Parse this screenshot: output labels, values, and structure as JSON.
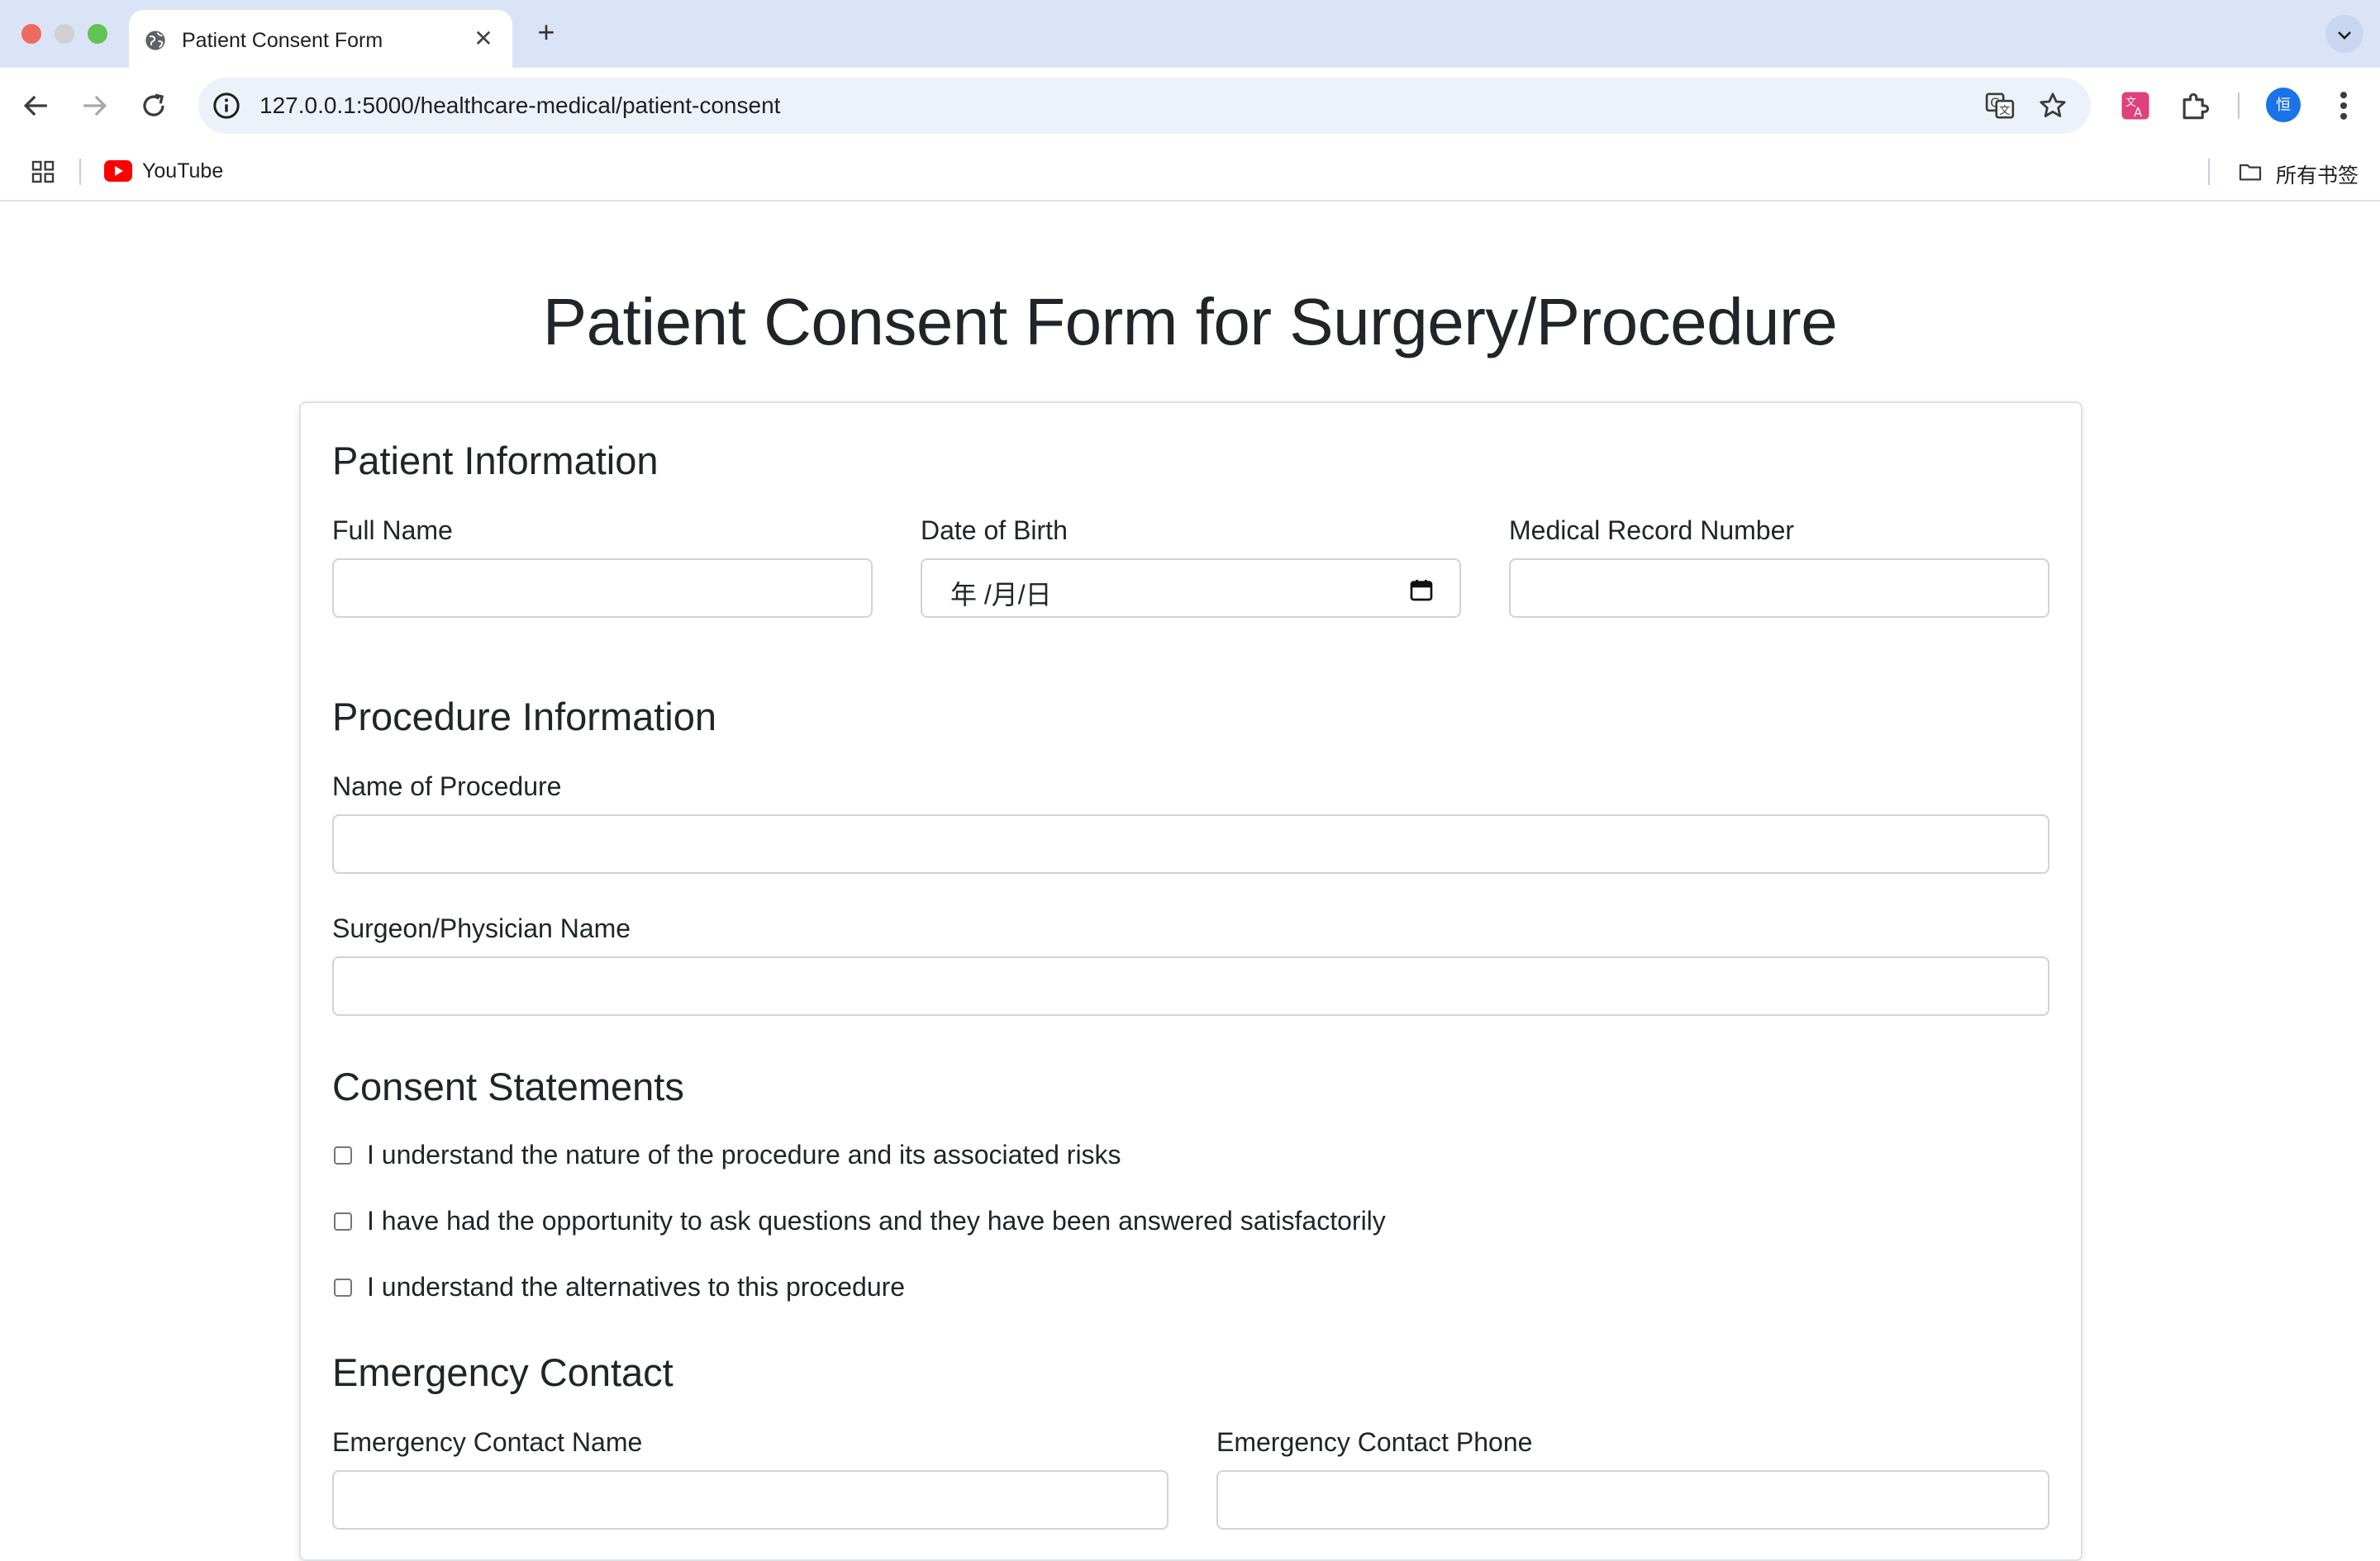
{
  "browser": {
    "tab_title": "Patient Consent Form",
    "url": "127.0.0.1:5000/healthcare-medical/patient-consent",
    "avatar_initial": "恒",
    "bookmarks": [
      {
        "label": "YouTube",
        "icon": "youtube-icon"
      }
    ],
    "all_bookmarks_label": "所有书签"
  },
  "page": {
    "title": "Patient Consent Form for Surgery/Procedure"
  },
  "patient_info": {
    "heading": "Patient Information",
    "full_name_label": "Full Name",
    "full_name_value": "",
    "dob_label": "Date of Birth",
    "dob_placeholder": "年 /月/日",
    "mrn_label": "Medical Record Number",
    "mrn_value": ""
  },
  "procedure_info": {
    "heading": "Procedure Information",
    "procedure_name_label": "Name of Procedure",
    "procedure_name_value": "",
    "surgeon_label": "Surgeon/Physician Name",
    "surgeon_value": ""
  },
  "consent": {
    "heading": "Consent Statements",
    "statements": [
      {
        "text": "I understand the nature of the procedure and its associated risks",
        "checked": false
      },
      {
        "text": "I have had the opportunity to ask questions and they have been answered satisfactorily",
        "checked": false
      },
      {
        "text": "I understand the alternatives to this procedure",
        "checked": false
      }
    ]
  },
  "emergency": {
    "heading": "Emergency Contact",
    "name_label": "Emergency Contact Name",
    "phone_label": "Emergency Contact Phone"
  },
  "colors": {
    "tabbar_bg": "#dbe4f6",
    "omnibox_bg": "#edf2fa",
    "text": "#212529",
    "input_border": "#ced4da",
    "avatar": "#1a73e8"
  }
}
